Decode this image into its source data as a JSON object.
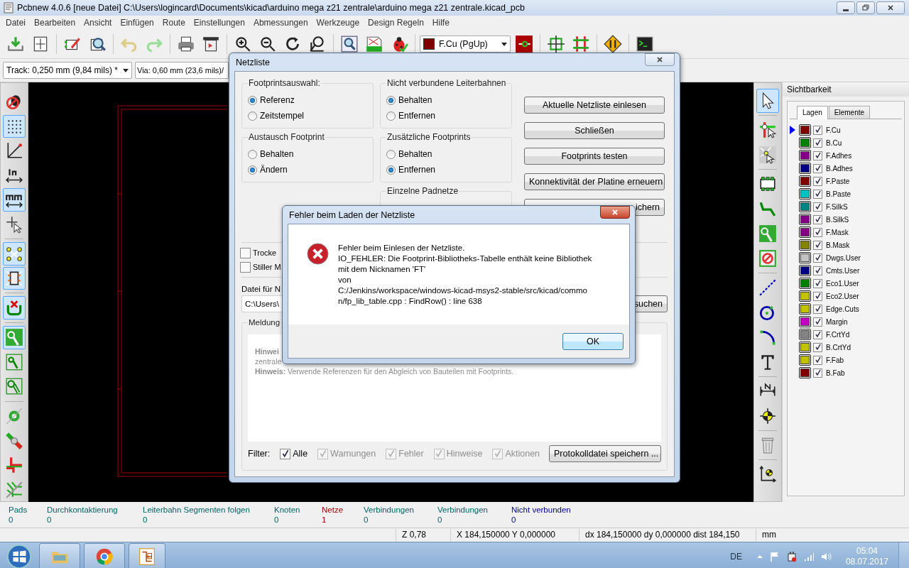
{
  "window": {
    "title": "Pcbnew 4.0.6  [neue Datei] C:\\Users\\logincard\\Documents\\kicad\\arduino mega z21 zentrale\\arduino mega z21 zentrale.kicad_pcb"
  },
  "menu": [
    "Datei",
    "Bearbeiten",
    "Ansicht",
    "Einfügen",
    "Route",
    "Einstellungen",
    "Abmessungen",
    "Werkzeuge",
    "Design Regeln",
    "Hilfe"
  ],
  "layer_select": {
    "value": "F.Cu (PgUp)",
    "color": "#800000"
  },
  "track_select": "Track: 0,250 mm (9,84 mils) *",
  "via_select": "Via: 0,60 mm (23,6 mils)/",
  "left_toolbar": [
    {
      "on": false
    },
    {
      "on": true
    },
    {
      "on": false
    },
    {
      "on": false
    },
    {
      "on": true
    },
    {
      "on": false
    },
    {
      "on": true
    },
    {
      "on": true
    },
    {
      "on": true
    },
    {
      "on": true
    },
    {
      "on": false
    },
    {
      "on": false
    },
    {
      "on": false
    },
    {
      "on": false
    },
    {
      "on": false
    },
    {
      "on": false
    }
  ],
  "right_toolbar": [
    {
      "on": true
    },
    {
      "on": false
    },
    {
      "on": false
    },
    {
      "on": false
    },
    {
      "on": false
    },
    {
      "on": false
    },
    {
      "on": false
    },
    {
      "on": false
    },
    {
      "on": false
    },
    {
      "on": false
    },
    {
      "on": false
    },
    {
      "on": false
    },
    {
      "on": false
    },
    {
      "on": false
    },
    {
      "on": false
    }
  ],
  "visibility_panel": {
    "title": "Sichtbarkeit",
    "tabs": [
      {
        "label": "Lagen",
        "selected": true
      },
      {
        "label": "Elemente",
        "selected": false
      }
    ],
    "layers": [
      {
        "name": "F.Cu",
        "color": "#800000",
        "checked": true,
        "selected": true
      },
      {
        "name": "B.Cu",
        "color": "#008000",
        "checked": true,
        "selected": false
      },
      {
        "name": "F.Adhes",
        "color": "#840084",
        "checked": true,
        "selected": false
      },
      {
        "name": "B.Adhes",
        "color": "#000084",
        "checked": true,
        "selected": false
      },
      {
        "name": "F.Paste",
        "color": "#800000",
        "checked": true,
        "selected": false
      },
      {
        "name": "B.Paste",
        "color": "#00c2c2",
        "checked": true,
        "selected": false
      },
      {
        "name": "F.SilkS",
        "color": "#008484",
        "checked": true,
        "selected": false
      },
      {
        "name": "B.SilkS",
        "color": "#840084",
        "checked": true,
        "selected": false
      },
      {
        "name": "F.Mask",
        "color": "#840084",
        "checked": true,
        "selected": false
      },
      {
        "name": "B.Mask",
        "color": "#848400",
        "checked": true,
        "selected": false
      },
      {
        "name": "Dwgs.User",
        "color": "#c2c2c2",
        "checked": true,
        "selected": false
      },
      {
        "name": "Cmts.User",
        "color": "#000084",
        "checked": true,
        "selected": false
      },
      {
        "name": "Eco1.User",
        "color": "#008000",
        "checked": true,
        "selected": false
      },
      {
        "name": "Eco2.User",
        "color": "#c2c200",
        "checked": true,
        "selected": false
      },
      {
        "name": "Edge.Cuts",
        "color": "#c2c200",
        "checked": true,
        "selected": false
      },
      {
        "name": "Margin",
        "color": "#c200c2",
        "checked": true,
        "selected": false
      },
      {
        "name": "F.CrtYd",
        "color": "#848484",
        "checked": true,
        "selected": false
      },
      {
        "name": "B.CrtYd",
        "color": "#c2c200",
        "checked": true,
        "selected": false
      },
      {
        "name": "F.Fab",
        "color": "#c2c200",
        "checked": true,
        "selected": false
      },
      {
        "name": "B.Fab",
        "color": "#800000",
        "checked": true,
        "selected": false
      }
    ]
  },
  "message_panel": [
    {
      "label": "Pads",
      "value": "0",
      "color": "#006464"
    },
    {
      "label": "Durchkontaktierung",
      "value": "0",
      "color": "#006464"
    },
    {
      "label": "Leiterbahn Segmenten folgen",
      "value": "0",
      "color": "#006464"
    },
    {
      "label": "Knoten",
      "value": "0",
      "color": "#006464"
    },
    {
      "label": "Netze",
      "value": "1",
      "color": "#a00000"
    },
    {
      "label": "Verbindungen",
      "value": "0",
      "color": "#006464"
    },
    {
      "label": "Verbindungen",
      "value": "0",
      "color": "#006464"
    },
    {
      "label": "Nicht verbunden",
      "value": "0",
      "color": "#000090"
    }
  ],
  "status_bar": [
    "Z 0,78",
    "X 184,150000  Y 0,000000",
    "dx 184,150000  dy 0,000000  dist 184,150",
    "mm"
  ],
  "taskbar": {
    "language": "DE",
    "time": "05:04",
    "date": "08.07.2017"
  },
  "netlist_dialog": {
    "title": "Netzliste",
    "groups": [
      {
        "title": "Footprintsauswahl:",
        "options": [
          {
            "label": "Referenz",
            "selected": true
          },
          {
            "label": "Zeitstempel",
            "selected": false
          }
        ]
      },
      {
        "title": "Nicht verbundene Leiterbahnen",
        "options": [
          {
            "label": "Behalten",
            "selected": true
          },
          {
            "label": "Entfernen",
            "selected": false
          }
        ]
      },
      {
        "title": "Austausch Footprint",
        "options": [
          {
            "label": "Behalten",
            "selected": false
          },
          {
            "label": "Ändern",
            "selected": true
          }
        ]
      },
      {
        "title": "Zusätzliche Footprints",
        "options": [
          {
            "label": "Behalten",
            "selected": false
          },
          {
            "label": "Entfernen",
            "selected": true
          }
        ]
      }
    ],
    "partial_group": "Einzelne Padnetze",
    "buttons": [
      "Aktuelle Netzliste einlesen",
      "Schließen",
      "Footprints testen",
      "Konnektivität der Platine erneuern",
      "ichern"
    ],
    "checkboxes": [
      {
        "label": "Trocke",
        "checked": false
      },
      {
        "label": "Stiller M",
        "checked": false
      }
    ],
    "file_label": "Datei für N",
    "file_value": "C:\\Users\\",
    "browse_button": "suchen",
    "messages_title": "Meldung",
    "messages": [
      {
        "prefix": "Hinwei"
      },
      {
        "text": "zentrale"
      },
      {
        "prefix": "Hinweis:",
        "text": "Verwende Referenzen für den Abgleich von Bauteilen mit Footprints."
      }
    ],
    "filter_label": "Filter:",
    "filters": [
      {
        "label": "Alle",
        "checked": true,
        "disabled": false
      },
      {
        "label": "Warnungen",
        "checked": true,
        "disabled": true
      },
      {
        "label": "Fehler",
        "checked": true,
        "disabled": true
      },
      {
        "label": "Hinweise",
        "checked": true,
        "disabled": true
      },
      {
        "label": "Aktionen",
        "checked": true,
        "disabled": true
      }
    ],
    "save_button": "Protokolldatei speichern ..."
  },
  "error_dialog": {
    "title": "Fehler beim Laden der Netzliste",
    "lines": [
      "Fehler beim Einlesen der Netzliste.",
      "IO_FEHLER: Die Footprint-Bibliotheks-Tabelle enthält keine Bibliothek",
      "mit dem Nicknamen 'FT'",
      "von",
      "C:/Jenkins/workspace/windows-kicad-msys2-stable/src/kicad/commo",
      "n/fp_lib_table.cpp : FindRow() : line 638"
    ],
    "ok": "OK"
  }
}
